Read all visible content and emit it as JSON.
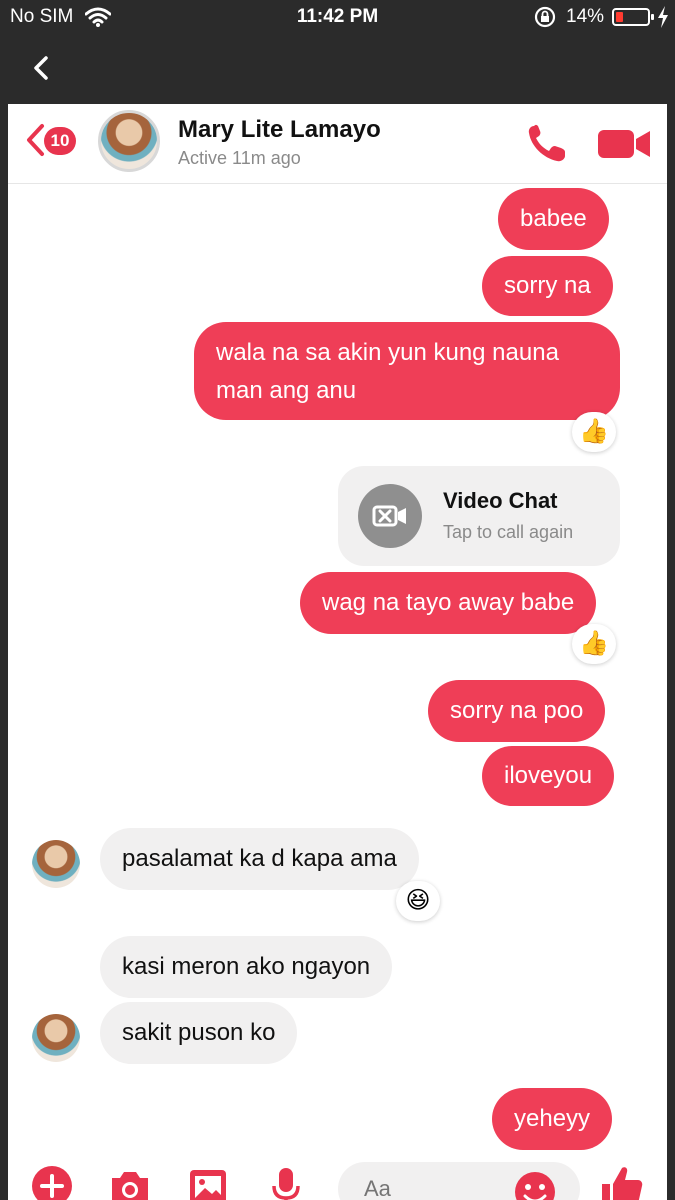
{
  "status": {
    "carrier": "No SIM",
    "time": "11:42 PM",
    "battery": "14%",
    "battery_level_percent": 14
  },
  "header": {
    "unread_count": "10",
    "contact_name": "Mary Lite Lamayo",
    "active_status": "Active 11m ago"
  },
  "messages": {
    "m1": "babee",
    "m2": "sorry na",
    "m3": "wala na sa akin yun kung nauna man ang anu",
    "video_chat_title": "Video Chat",
    "video_chat_sub": "Tap to call again",
    "m4": "wag na tayo away babe",
    "m5": "sorry na poo",
    "m6": "iloveyou",
    "m7": "pasalamat ka d kapa ama",
    "m8": "kasi meron ako ngayon",
    "m9": "sakit puson ko",
    "m10": "yeheyy"
  },
  "reactions": {
    "thumbs_up": "👍",
    "laugh": "😆"
  },
  "composer": {
    "placeholder": "Aa"
  },
  "colors": {
    "accent": "#ef3e57",
    "incoming_bubble": "#f1f0f0"
  },
  "icons": [
    "back-chevron-icon",
    "phone-icon",
    "video-camera-icon",
    "plus-icon",
    "camera-icon",
    "image-icon",
    "microphone-icon",
    "emoji-icon",
    "thumbs-up-icon"
  ]
}
